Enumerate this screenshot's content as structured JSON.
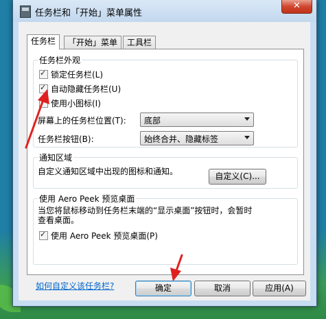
{
  "window": {
    "title": "任务栏和「开始」菜单属性",
    "close_label": "✕"
  },
  "tabs": [
    {
      "label": "任务栏"
    },
    {
      "label": "「开始」菜单"
    },
    {
      "label": "工具栏"
    }
  ],
  "appearance": {
    "title": "任务栏外观",
    "lock_taskbar": "锁定任务栏(L)",
    "auto_hide": "自动隐藏任务栏(U)",
    "small_icons": "使用小图标(I)",
    "location_label": "屏幕上的任务栏位置(T):",
    "location_value": "底部",
    "buttons_label": "任务栏按钮(B):",
    "buttons_value": "始终合并、隐藏标签"
  },
  "notification": {
    "title": "通知区域",
    "desc": "自定义通知区域中出现的图标和通知。",
    "customize_button": "自定义(C)..."
  },
  "aero_peek": {
    "title": "使用 Aero Peek 预览桌面",
    "desc_line1": "当您将鼠标移动到任务栏末端的“显示桌面”按钮时，会暂时",
    "desc_line2": "查看桌面。",
    "checkbox": "使用 Aero Peek 预览桌面(P)"
  },
  "help_link": "如何自定义该任务栏?",
  "buttons": {
    "ok": "确定",
    "cancel": "取消",
    "apply": "应用(A)"
  },
  "colors": {
    "annotation_arrow": "#e02020",
    "link": "#0066cc",
    "accent_border": "#3c7fb1"
  }
}
